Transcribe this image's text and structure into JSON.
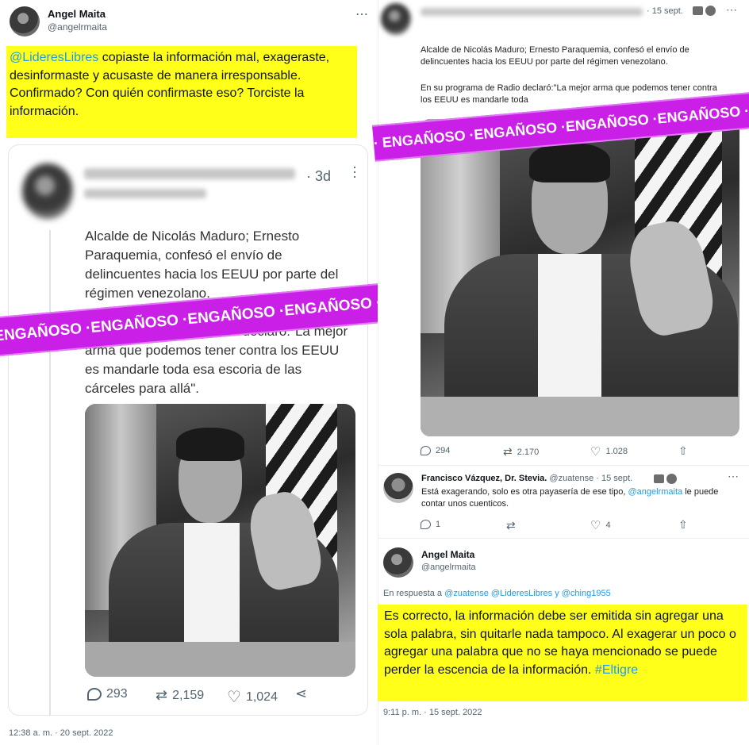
{
  "left": {
    "author": {
      "name": "Angel Maita",
      "handle": "@angelrmaita"
    },
    "more_icon": "⋯",
    "reply": {
      "mention": "@LideresLibres",
      "text": " copiaste la información mal, exageraste, desinformaste y acusaste de manera irresponsable.",
      "text2": "Confirmado? Con quién confirmaste eso? Torciste la información."
    },
    "quoted": {
      "age": "· 3d",
      "body1": "Alcalde de Nicolás Maduro; Ernesto Paraquemia, confesó el envío de delincuentes hacia los EEUU por parte del régimen venezolano.",
      "body2": "En su programa de Radio declaró:\"La mejor arma que podemos tener contra los EEUU es mandarle toda esa escoria de las cárceles para allá\".",
      "stats": {
        "replies": "293",
        "retweets": "2,159",
        "likes": "1,024"
      }
    },
    "timestamp": "12:38 a. m. · 20 sept. 2022"
  },
  "right": {
    "top": {
      "date": "· 15 sept.",
      "body1": "Alcalde de Nicolás Maduro; Ernesto Paraquemia, confesó el envío de delincuentes hacia los EEUU por parte del régimen venezolano.",
      "body2": "En su programa de Radio declaró:\"La mejor arma que podemos tener contra los EEUU es mandarle toda",
      "stats": {
        "replies": "294",
        "retweets": "2.170",
        "likes": "1.028"
      }
    },
    "reply1": {
      "name": "Francisco Vázquez, Dr. Stevia.",
      "handle": "@zuatense · 15 sept.",
      "text": "Está exagerando, solo es otra payasería de ese tipo, ",
      "mention": "@angelrmaita",
      "text_end": " le puede contar unos cuenticos.",
      "stats": {
        "replies": "1",
        "likes": "4"
      }
    },
    "reply2": {
      "name": "Angel Maita",
      "handle": "@angelrmaita",
      "in_reply_prefix": "En respuesta a ",
      "in_reply_users": "@zuatense @LideresLibres y @ching1955",
      "text": "Es correcto, la información debe ser emitida sin agregar una sola palabra, sin quitarle nada tampoco. Al exagerar un poco o agregar una palabra que no se haya mencionado se puede perder la escencia de la información. ",
      "hashtag": "#Eltigre",
      "timestamp": "9:11 p. m. · 15 sept. 2022"
    }
  },
  "tape_text": "· ENGAÑOSO ·ENGAÑOSO ·ENGAÑOSO ·ENGAÑOSO ·ENGAÑOSO",
  "colors": {
    "highlight": "#ffff1a",
    "link": "#1d9bf0",
    "tape": "#c91fe6"
  }
}
